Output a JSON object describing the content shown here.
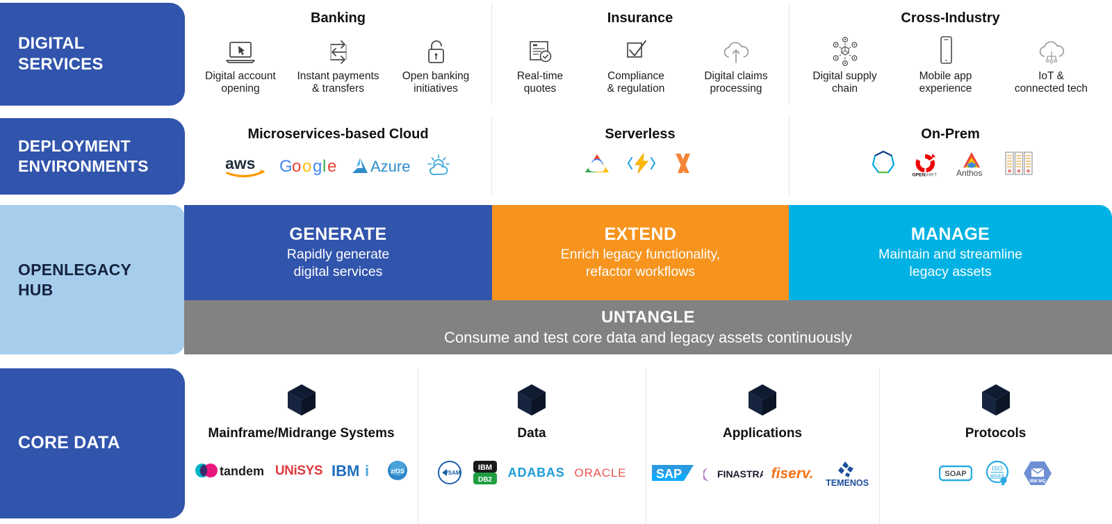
{
  "rows": {
    "digital_services": {
      "label": "DIGITAL\nSERVICES",
      "groups": [
        {
          "title": "Banking",
          "items": [
            {
              "icon": "laptop-cursor-icon",
              "caption": "Digital account\nopening"
            },
            {
              "icon": "transfer-arrows-icon",
              "caption": "Instant payments\n& transfers"
            },
            {
              "icon": "open-padlock-icon",
              "caption": "Open banking\ninitiatives"
            }
          ]
        },
        {
          "title": "Insurance",
          "items": [
            {
              "icon": "document-check-icon",
              "caption": "Real-time\nquotes"
            },
            {
              "icon": "checkbox-tick-icon",
              "caption": "Compliance\n& regulation"
            },
            {
              "icon": "cloud-upload-icon",
              "caption": "Digital claims\nprocessing"
            }
          ]
        },
        {
          "title": "Cross-Industry",
          "items": [
            {
              "icon": "supply-chain-network-icon",
              "caption": "Digital supply\nchain"
            },
            {
              "icon": "mobile-phone-icon",
              "caption": "Mobile app\nexperience"
            },
            {
              "icon": "iot-cloud-icon",
              "caption": "IoT &\nconnected tech"
            }
          ]
        }
      ]
    },
    "deployment_environments": {
      "label": "DEPLOYMENT\nENVIRONMENTS",
      "groups": [
        {
          "title": "Microservices-based Cloud",
          "logos": [
            "aws",
            "Google",
            "Azure",
            "IBM Cloud"
          ]
        },
        {
          "title": "Serverless",
          "logos": [
            "Google Cloud Functions",
            "Azure Functions",
            "AWS Lambda"
          ]
        },
        {
          "title": "On-Prem",
          "logos": [
            "Pivotal",
            "OPENSHIFT",
            "Anthos",
            "Data Center"
          ]
        }
      ]
    },
    "openlegacy_hub": {
      "label": "OPENLEGACY\nHUB",
      "bars": [
        {
          "title": "GENERATE",
          "subtitle": "Rapidly generate\ndigital services",
          "color": "#3154AC"
        },
        {
          "title": "EXTEND",
          "subtitle": "Enrich legacy functionality,\nrefactor workflows",
          "color": "#F7941E"
        },
        {
          "title": "MANAGE",
          "subtitle": "Maintain and streamline\nlegacy assets",
          "color": "#00B2E3"
        }
      ],
      "untangle": {
        "title": "UNTANGLE",
        "subtitle": "Consume and test core data and legacy assets continuously",
        "color": "#828282"
      }
    },
    "core_data": {
      "label": "CORE DATA",
      "columns": [
        {
          "name": "Mainframe/Midrange Systems",
          "icon": "cube-icon",
          "logos": [
            "tandem",
            "UNISYS",
            "IBM i",
            "z/OS"
          ]
        },
        {
          "name": "Data",
          "icon": "cube-icon",
          "logos": [
            "VSAM",
            "IBM DB2",
            "ADABAS",
            "ORACLE"
          ]
        },
        {
          "name": "Applications",
          "icon": "cube-icon",
          "logos": [
            "SAP",
            "FINASTRA",
            "fiserv.",
            "TEMENOS"
          ]
        },
        {
          "name": "Protocols",
          "icon": "cube-icon",
          "logos": [
            "SOAP",
            "ISO 8583",
            "IBM MQ"
          ]
        }
      ]
    }
  },
  "colors": {
    "navy": "#3154AC",
    "light_blue": "#A6CEEC",
    "orange": "#F7941E",
    "cyan": "#00B2E3",
    "gray": "#828282",
    "divider": "#e6e6e6"
  }
}
